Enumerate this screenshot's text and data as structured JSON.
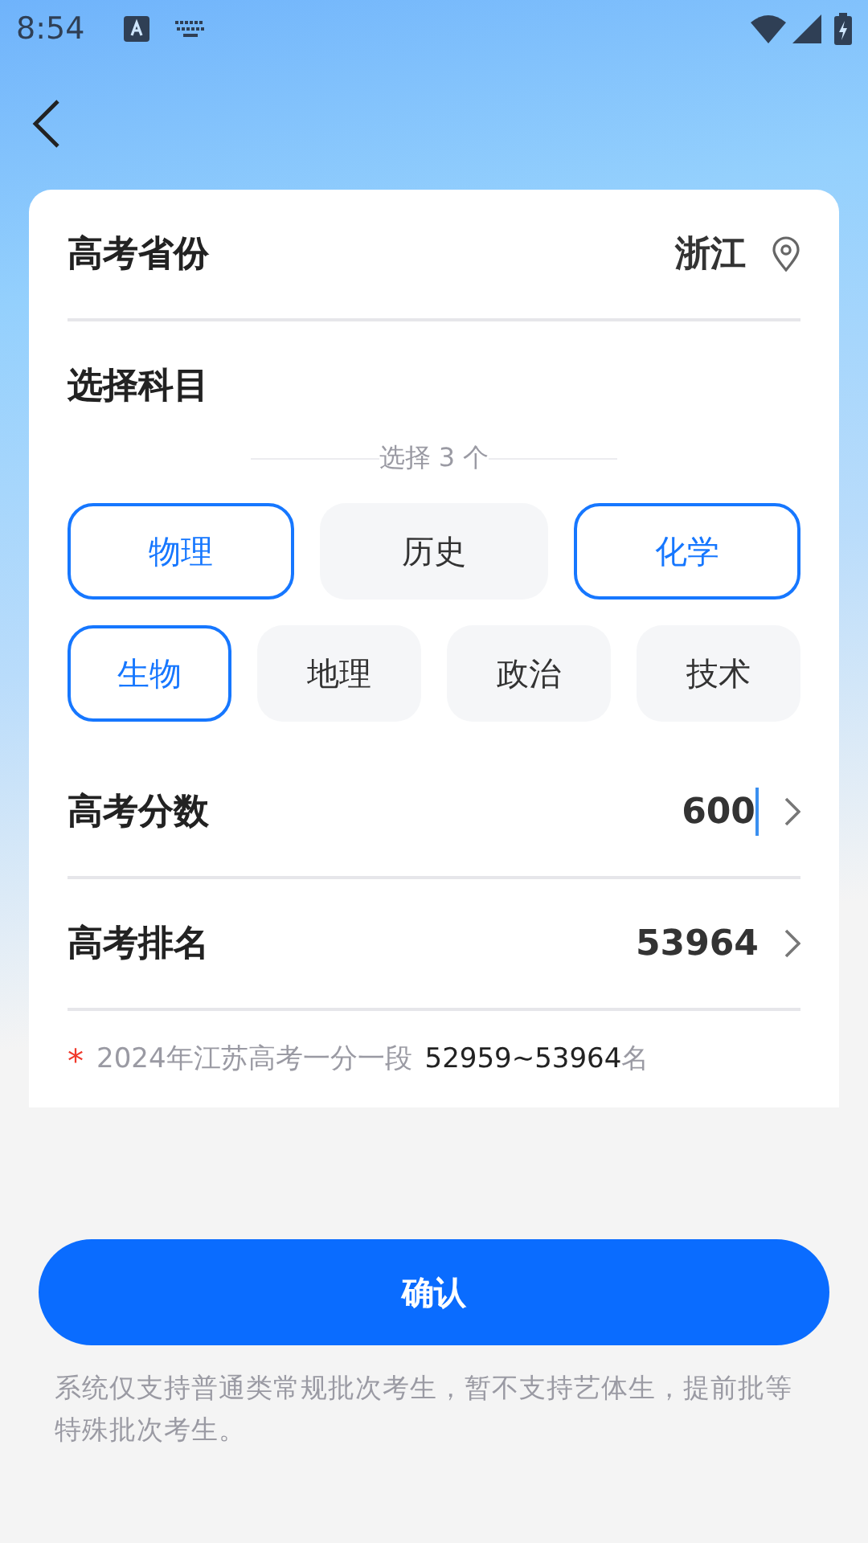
{
  "status_bar": {
    "time": "8:54"
  },
  "province": {
    "label": "高考省份",
    "value": "浙江"
  },
  "subjects": {
    "title": "选择科目",
    "hint": "选择 3 个",
    "rows": [
      {
        "chips": [
          {
            "label": "物理",
            "selected": true
          },
          {
            "label": "历史",
            "selected": false
          },
          {
            "label": "化学",
            "selected": true
          }
        ]
      },
      {
        "chips": [
          {
            "label": "生物",
            "selected": true
          },
          {
            "label": "地理",
            "selected": false
          },
          {
            "label": "政治",
            "selected": false
          },
          {
            "label": "技术",
            "selected": false
          }
        ]
      }
    ]
  },
  "fields": [
    {
      "label": "高考分数",
      "value": "600",
      "focused": true
    },
    {
      "label": "高考排名",
      "value": "53964",
      "focused": false
    }
  ],
  "note": {
    "mark": "*",
    "text": "2024年江苏高考一分一段",
    "range": "52959~53964",
    "suffix": "名"
  },
  "confirm_button": "确认",
  "footer": "系统仅支持普通类常规批次考生，暂不支持艺体生，提前批等特殊批次考生。"
}
